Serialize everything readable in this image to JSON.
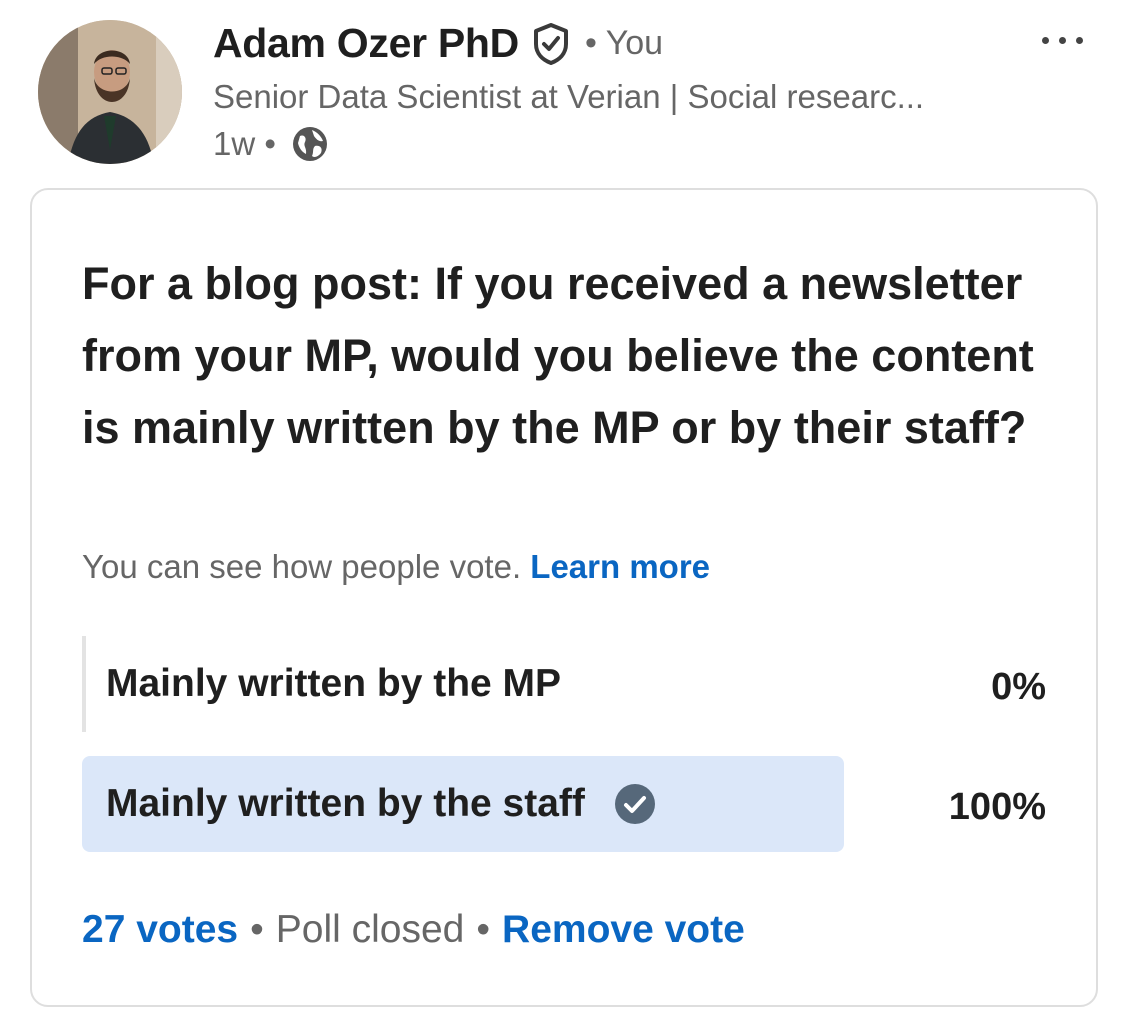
{
  "post": {
    "author_name": "Adam Ozer PhD",
    "you_label": "• You",
    "headline": "Senior Data Scientist at Verian | Social researc...",
    "time": "1w •"
  },
  "poll": {
    "question": "For a blog post: If you received a newsletter from your MP, would you believe the content is mainly written by the MP or by their staff?",
    "visibility_note": "You can see how people vote.",
    "learn_more": "Learn more",
    "options": [
      {
        "label": "Mainly written by the MP",
        "percent": "0%",
        "selected": false
      },
      {
        "label": "Mainly written by the staff",
        "percent": "100%",
        "selected": true
      }
    ],
    "votes": "27 votes",
    "status": "Poll closed",
    "remove_vote": "Remove vote"
  },
  "colors": {
    "link": "#0a66c2",
    "selected_option_bg": "#dbe7f9",
    "muted_text": "#666666"
  },
  "icons": {
    "verified": "verified-shield-icon",
    "visibility": "globe-icon",
    "selected": "check-circle-icon",
    "menu": "more-dots-icon"
  }
}
